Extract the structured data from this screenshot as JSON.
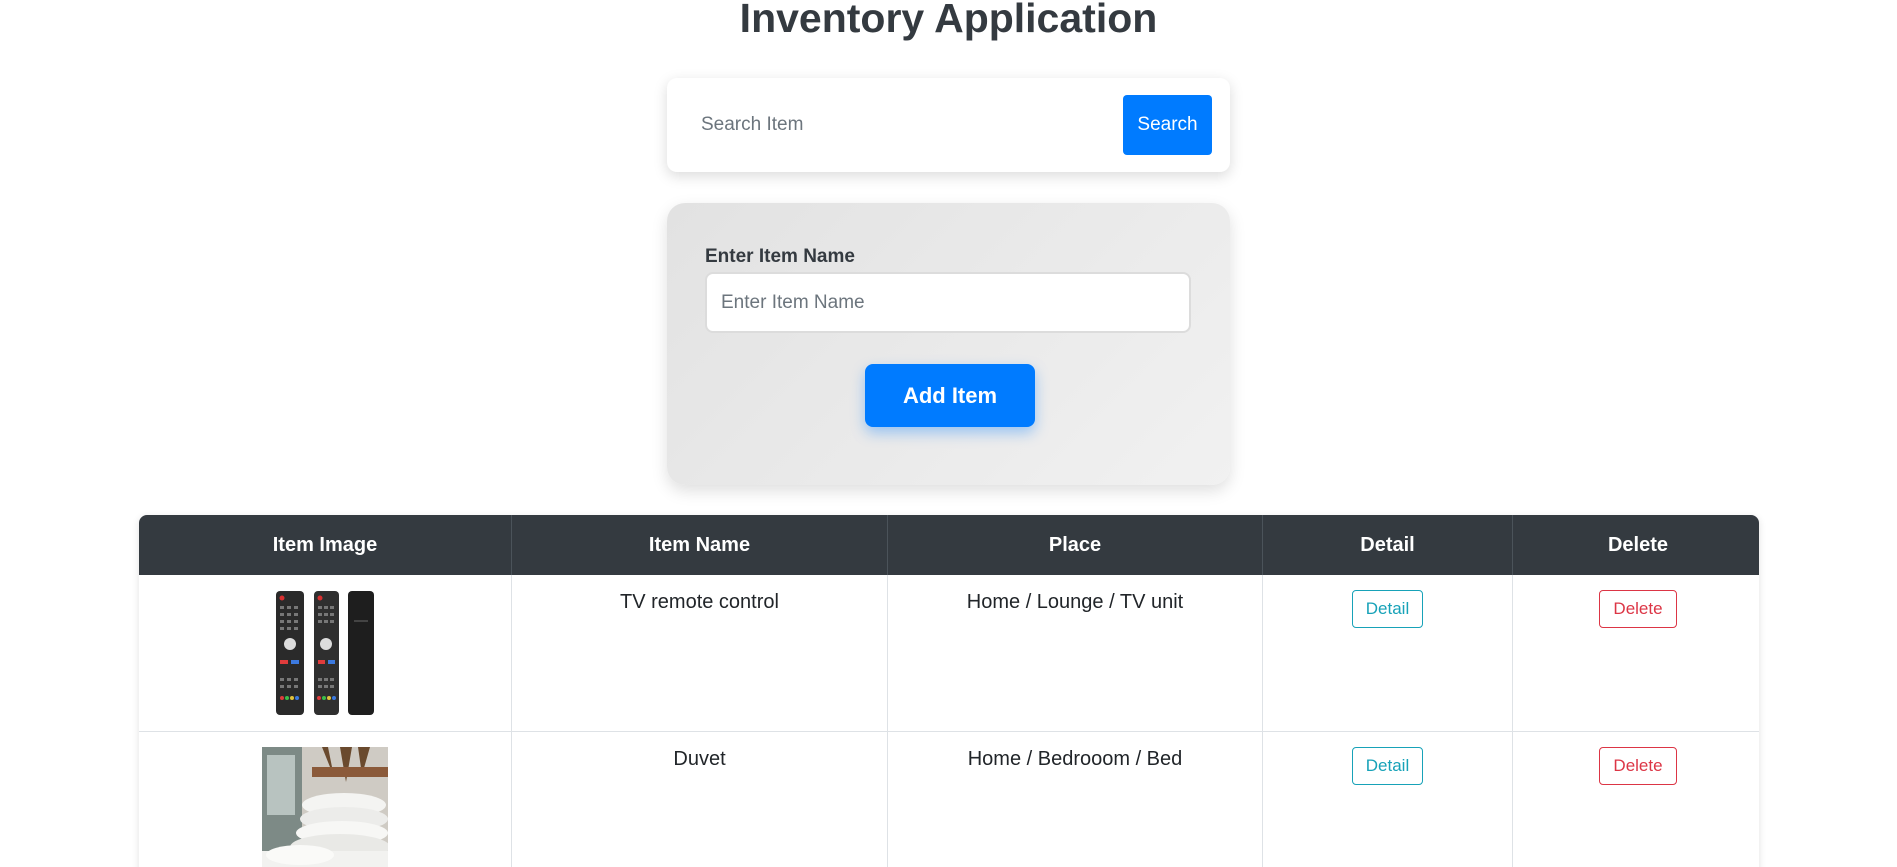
{
  "header": {
    "title": "Inventory Application"
  },
  "search": {
    "placeholder": "Search Item",
    "value": "",
    "button_label": "Search"
  },
  "add_item": {
    "label": "Enter Item Name",
    "placeholder": "Enter Item Name",
    "value": "",
    "button_label": "Add Item"
  },
  "table": {
    "columns": [
      "Item Image",
      "Item Name",
      "Place",
      "Detail",
      "Delete"
    ],
    "rows": [
      {
        "image_icon": "tv-remote-image",
        "name": "TV remote control",
        "place": "Home / Lounge / TV unit",
        "detail_label": "Detail",
        "delete_label": "Delete"
      },
      {
        "image_icon": "duvet-image",
        "name": "Duvet",
        "place": "Home / Bedrooom / Bed",
        "detail_label": "Detail",
        "delete_label": "Delete"
      }
    ]
  },
  "colors": {
    "primary": "#007bff",
    "header_dark": "#343a40",
    "info": "#17a2b8",
    "danger": "#dc3545"
  }
}
